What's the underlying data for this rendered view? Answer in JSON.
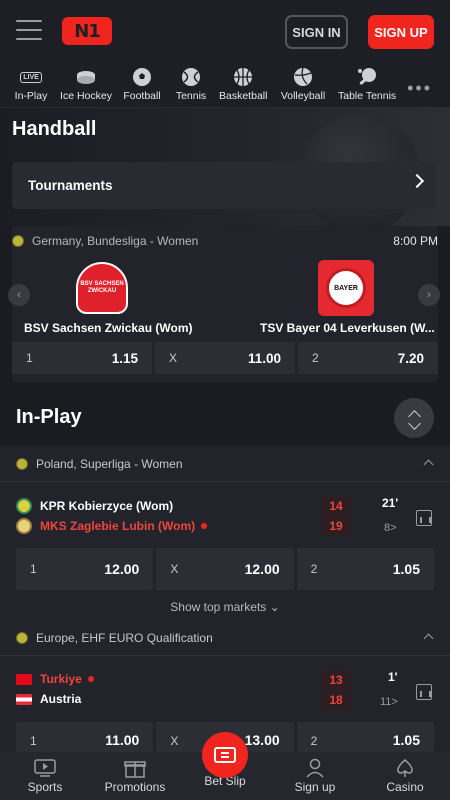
{
  "header": {
    "logo_text": "N1",
    "signin_label": "SIGN IN",
    "signup_label": "SIGN UP"
  },
  "sports_nav": {
    "items": [
      {
        "label": "In-Play",
        "icon": "live-tv-icon",
        "badge": "LIVE"
      },
      {
        "label": "Ice Hockey",
        "icon": "puck-icon"
      },
      {
        "label": "Football",
        "icon": "soccer-ball-icon"
      },
      {
        "label": "Tennis",
        "icon": "tennis-ball-icon"
      },
      {
        "label": "Basketball",
        "icon": "basketball-icon"
      },
      {
        "label": "Volleyball",
        "icon": "volleyball-icon"
      },
      {
        "label": "Table Tennis",
        "icon": "table-tennis-icon"
      }
    ],
    "more_label": "•••"
  },
  "hero": {
    "title": "Handball",
    "tournaments_label": "Tournaments"
  },
  "featured": {
    "league": "Germany, Bundesliga - Women",
    "time": "8:00 PM",
    "home": {
      "name": "BSV Sachsen Zwickau (Wom)",
      "crest_text": "BSV SACHSEN ZWICKAU"
    },
    "away": {
      "name": "TSV Bayer 04 Leverkusen (W...",
      "crest_text": "BAYER"
    },
    "odds": [
      {
        "label": "1",
        "value": "1.15"
      },
      {
        "label": "X",
        "value": "11.00"
      },
      {
        "label": "2",
        "value": "7.20"
      }
    ]
  },
  "inplay": {
    "title": "In-Play",
    "sections": [
      {
        "league": "Poland, Superliga - Women",
        "match": {
          "home": "KPR Kobierzyce (Wom)",
          "away": "MKS Zaglebie Lubin (Wom)",
          "home_score": "14",
          "away_score": "19",
          "minute": "21'",
          "markets": "8>",
          "odds": [
            {
              "label": "1",
              "value": "12.00"
            },
            {
              "label": "X",
              "value": "12.00"
            },
            {
              "label": "2",
              "value": "1.05"
            }
          ]
        },
        "show_more": "Show top markets"
      },
      {
        "league": "Europe, EHF EURO Qualification",
        "match": {
          "home": "Turkiye",
          "away": "Austria",
          "home_score": "13",
          "away_score": "18",
          "minute": "1'",
          "markets": "11>",
          "odds": [
            {
              "label": "1",
              "value": "11.00"
            },
            {
              "label": "X",
              "value": "13.00"
            },
            {
              "label": "2",
              "value": "1.05"
            }
          ]
        }
      }
    ]
  },
  "bottom_bar": {
    "items": [
      {
        "label": "Sports",
        "icon": "tv-icon"
      },
      {
        "label": "Promotions",
        "icon": "gift-icon"
      },
      {
        "label": "Bet Slip",
        "icon": "ticket-icon"
      },
      {
        "label": "Sign up",
        "icon": "user-icon"
      },
      {
        "label": "Casino",
        "icon": "spade-icon"
      }
    ]
  },
  "colors": {
    "accent": "#f0251d",
    "background": "#1b1c22",
    "panel": "#23242b",
    "odds_bg": "#2d2e35"
  }
}
